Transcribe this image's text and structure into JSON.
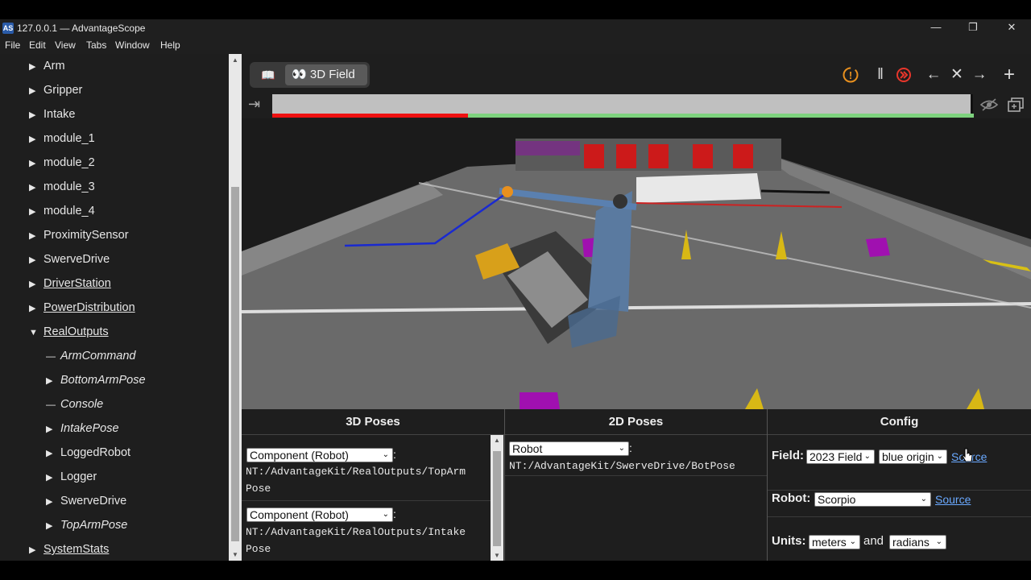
{
  "window": {
    "title": "127.0.0.1 — AdvantageScope",
    "app_icon": "AS",
    "minimize": "—",
    "maximize": "❐",
    "close": "✕"
  },
  "menu": [
    "File",
    "Edit",
    "View",
    "Tabs",
    "Window",
    "Help"
  ],
  "sidebar": {
    "items": [
      {
        "label": "Arm",
        "expand": "▶"
      },
      {
        "label": "Gripper",
        "expand": "▶"
      },
      {
        "label": "Intake",
        "expand": "▶"
      },
      {
        "label": "module_1",
        "expand": "▶"
      },
      {
        "label": "module_2",
        "expand": "▶"
      },
      {
        "label": "module_3",
        "expand": "▶"
      },
      {
        "label": "module_4",
        "expand": "▶"
      },
      {
        "label": "ProximitySensor",
        "expand": "▶"
      },
      {
        "label": "SwerveDrive",
        "expand": "▶"
      },
      {
        "label": "DriverStation",
        "expand": "▶"
      },
      {
        "label": "PowerDistribution",
        "expand": "▶"
      },
      {
        "label": "RealOutputs",
        "expand": "▼"
      },
      {
        "label": "ArmCommand",
        "expand": "—"
      },
      {
        "label": "BottomArmPose",
        "expand": "▶"
      },
      {
        "label": "Console",
        "expand": "—"
      },
      {
        "label": "IntakePose",
        "expand": "▶"
      },
      {
        "label": "LoggedRobot",
        "expand": "▶"
      },
      {
        "label": "Logger",
        "expand": "▶"
      },
      {
        "label": "SwerveDrive",
        "expand": "▶"
      },
      {
        "label": "TopArmPose",
        "expand": "▶"
      },
      {
        "label": "SystemStats",
        "expand": "▶"
      }
    ]
  },
  "tabs": {
    "doc_icon": "📖",
    "active_label": "3D Field",
    "active_icon": "👀"
  },
  "controls": {
    "alert_icon": "!",
    "pause_icon": "‖",
    "live_icon": "◉",
    "back_icon": "←",
    "close_icon": "✕",
    "forward_icon": "→",
    "add_icon": "+",
    "popout_icon": "⇥",
    "hide_icon": "◉",
    "window_icon": "⧉"
  },
  "panels": {
    "poses3d": {
      "header": "3D Poses",
      "entries": [
        {
          "type": "Component (Robot)",
          "path_line1": "NT:/AdvantageKit/RealOutputs/TopArm",
          "path_line2": "Pose"
        },
        {
          "type": "Component (Robot)",
          "path_line1": "NT:/AdvantageKit/RealOutputs/Intake",
          "path_line2": "Pose"
        }
      ]
    },
    "poses2d": {
      "header": "2D Poses",
      "entries": [
        {
          "type": "Robot",
          "path": "NT:/AdvantageKit/SwerveDrive/BotPose"
        }
      ]
    },
    "config": {
      "header": "Config",
      "field_label": "Field:",
      "field_value": "2023 Field",
      "origin_value": "blue origin",
      "source_label": "Source",
      "robot_label": "Robot:",
      "robot_value": "Scorpio",
      "units_label": "Units:",
      "units_dist": "meters",
      "units_and": "and",
      "units_angle": "radians"
    }
  },
  "colors": {
    "accent_orange": "#e8901e",
    "live_red": "#e8362b",
    "timeline_red": "#ee1111",
    "timeline_green": "#7ed27e",
    "link_blue": "#6aa9ff"
  }
}
